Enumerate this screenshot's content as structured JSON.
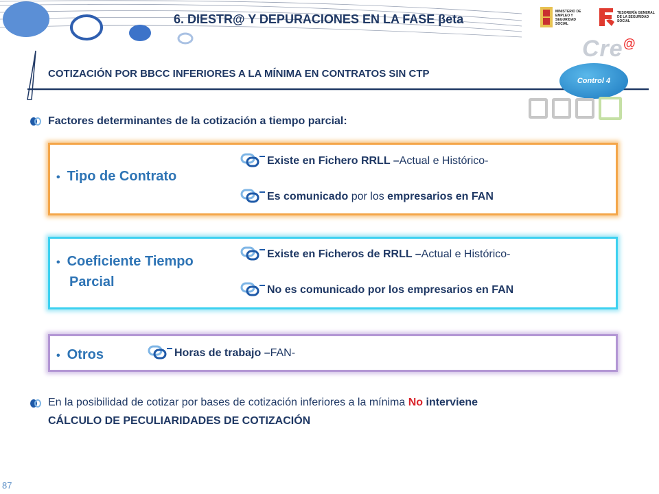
{
  "header": {
    "title": "6. DIESTR@ Y DEPURACIONES EN LA FASE βeta",
    "subtitle": "COTIZACIÓN POR BBCC INFERIORES A LA MÍNIMA EN CONTRATOS SIN CTP",
    "control_badge": "Control 4",
    "gov_logo_text": "MINISTERIO DE EMPLEO Y SEGURIDAD SOCIAL",
    "tgss_logo_text": "TESORERÍA GENERAL DE LA SEGURIDAD SOCIAL",
    "brand_text": "Cre",
    "brand_sup": "@"
  },
  "intro": "Factores determinantes de la cotización a tiempo parcial:",
  "panels": [
    {
      "category": "Tipo de Contrato",
      "items": [
        {
          "bold": "Existe en Fichero RRLL –",
          "normal": "Actual e Histórico-"
        },
        {
          "bold": "Es comunicado",
          "normal": " por los ",
          "bold2": "empresarios en FAN"
        }
      ]
    },
    {
      "category_line1": "Coeficiente Tiempo",
      "category_line2": "Parcial",
      "items": [
        {
          "bold": "Existe en Ficheros de RRLL –",
          "normal": "Actual e Histórico-"
        },
        {
          "bold": "No es comunicado por los empresarios en FAN"
        }
      ]
    },
    {
      "category": "Otros",
      "items": [
        {
          "bold": "Horas de trabajo –",
          "normal": "FAN-"
        }
      ]
    }
  ],
  "footer_note": {
    "part1": "En la posibilidad de cotizar por bases de cotización inferiores a la mínima ",
    "highlight": "No",
    "part2": " interviene",
    "line2": "CÁLCULO DE PECULIARIDADES DE COTIZACIÓN"
  },
  "page_number": "87",
  "colors": {
    "title": "#1f3864",
    "category": "#2e74b5",
    "orange_border": "#f4a64a",
    "cyan_border": "#3dd1f0",
    "purple_border": "#b396d4",
    "highlight_red": "#d9242b"
  }
}
